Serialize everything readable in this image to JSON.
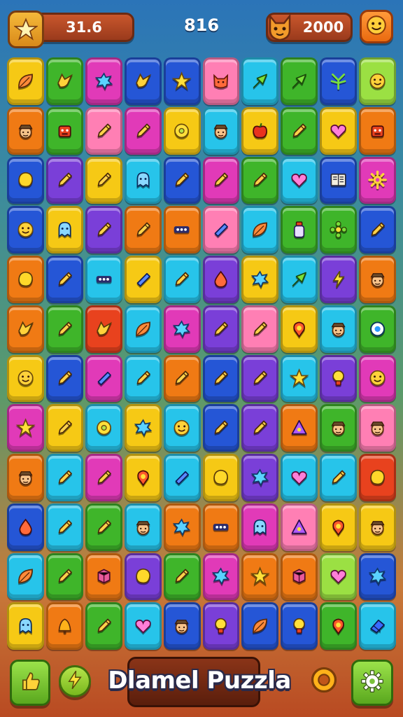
{
  "hud": {
    "left_value": "31.6",
    "center_score": "816",
    "right_value": "2000",
    "left_icon": "star-icon",
    "right_icon": "fox-icon",
    "corner_icon": "smiley-icon"
  },
  "footer": {
    "title": "Dlamel Puzzla",
    "buttons": [
      "thumbs-up-icon",
      "lightning-icon",
      "ring-icon",
      "gear-icon"
    ]
  },
  "colors": {
    "Y": "#f6c915",
    "O": "#f07a14",
    "R": "#e8421e",
    "G": "#3fb52a",
    "B": "#2556d6",
    "C": "#27c4ea",
    "P": "#7a3fd8",
    "M": "#e13ab8",
    "K": "#ff7fb4",
    "L": "#9be043"
  },
  "board": {
    "rows": [
      [
        "Y:leaf-icon",
        "G:bird-icon",
        "M:splat-icon",
        "B:bird-icon",
        "B:star-icon",
        "K:cat-icon",
        "C:arrow-icon",
        "G:arrow-icon",
        "B:plant-icon",
        "L:face-icon"
      ],
      [
        "O:hat-face-icon",
        "G:robot-icon",
        "K:pencil-icon",
        "M:pencil-icon",
        "Y:donut-icon",
        "C:hat-face-icon",
        "Y:apple-icon",
        "G:pencil-icon",
        "Y:heart-icon",
        "O:robot-icon"
      ],
      [
        "B:blob-icon",
        "P:pencil-icon",
        "Y:pencil-icon",
        "C:ghost-icon",
        "B:pencil-icon",
        "M:pencil-icon",
        "G:pencil-icon",
        "C:heart-icon",
        "B:book-icon",
        "M:gear-icon"
      ],
      [
        "B:face-icon",
        "Y:ghost-icon",
        "P:pencil-icon",
        "O:pencil-icon",
        "O:dots-icon",
        "K:stick-icon",
        "C:leaf-icon",
        "G:bottle-icon",
        "G:flower-icon",
        "B:pencil-icon"
      ],
      [
        "O:blob-icon",
        "B:pencil-icon",
        "C:dots-icon",
        "Y:stick-icon",
        "C:pencil-icon",
        "P:drop-icon",
        "Y:splat-icon",
        "C:arrow-icon",
        "P:bolt-icon",
        "O:hat-face-icon"
      ],
      [
        "O:bird-icon",
        "G:pencil-icon",
        "R:bird-icon",
        "C:leaf-icon",
        "M:splat-icon",
        "P:pencil-icon",
        "K:pencil-icon",
        "Y:pin-icon",
        "C:hat-face-icon",
        "G:eye-icon"
      ],
      [
        "Y:face-icon",
        "B:pencil-icon",
        "M:stick-icon",
        "C:pencil-icon",
        "O:pencil-icon",
        "B:pencil-icon",
        "P:pencil-icon",
        "C:star-icon",
        "P:bulb-icon",
        "M:face-icon"
      ],
      [
        "M:star-icon",
        "Y:pencil-icon",
        "C:donut-icon",
        "Y:splat-icon",
        "C:face-icon",
        "B:pencil-icon",
        "P:pencil-icon",
        "O:triangle-icon",
        "G:hat-face-icon",
        "K:hat-face-icon"
      ],
      [
        "O:hat-face-icon",
        "C:pencil-icon",
        "M:pencil-icon",
        "Y:pin-icon",
        "C:stick-icon",
        "Y:blob-icon",
        "P:splat-icon",
        "C:heart-icon",
        "C:pencil-icon",
        "R:blob-icon"
      ],
      [
        "B:drop-icon",
        "C:pencil-icon",
        "G:pencil-icon",
        "C:hat-face-icon",
        "O:splat-icon",
        "O:dots-icon",
        "M:ghost-icon",
        "K:triangle-icon",
        "Y:pin-icon",
        "Y:hat-face-icon"
      ],
      [
        "C:leaf-icon",
        "G:pencil-icon",
        "O:box-icon",
        "P:blob-icon",
        "G:pencil-icon",
        "M:splat-icon",
        "O:star-icon",
        "O:box-icon",
        "L:heart-icon",
        "B:splat-icon"
      ],
      [
        "Y:ghost-icon",
        "O:bell-icon",
        "G:pencil-icon",
        "C:heart-icon",
        "B:hat-face-icon",
        "P:bulb-icon",
        "B:leaf-icon",
        "B:bulb-icon",
        "G:pin-icon",
        "C:eraser-icon"
      ]
    ]
  }
}
